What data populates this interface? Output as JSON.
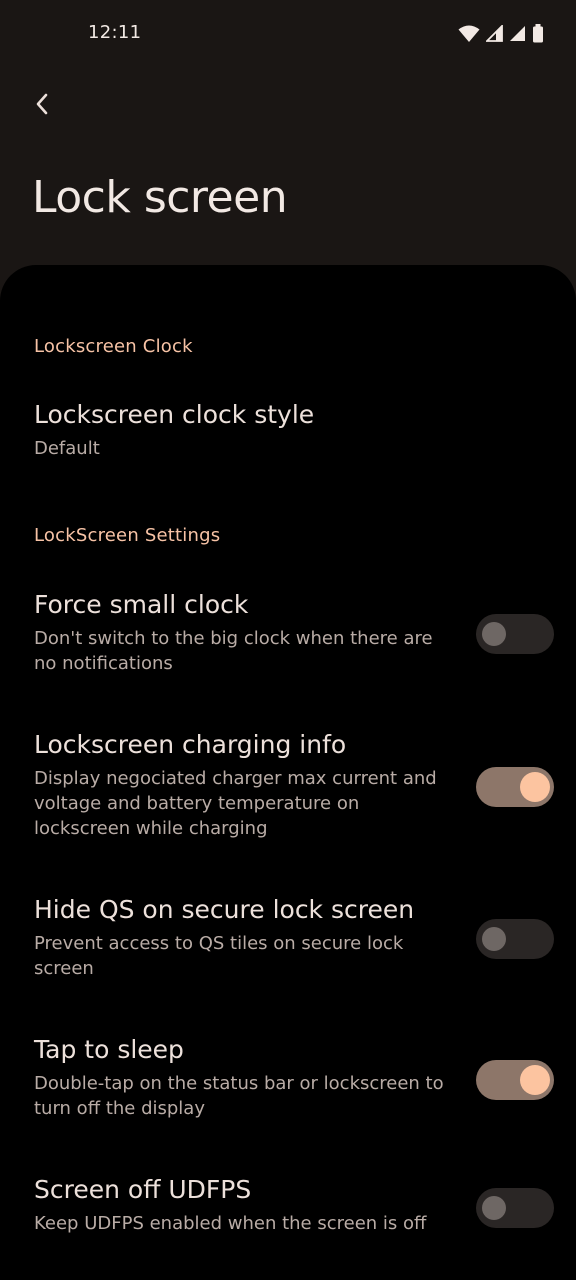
{
  "status_bar": {
    "time": "12:11",
    "icons": [
      "wifi-icon",
      "signal-icon",
      "signal-icon",
      "battery-icon"
    ]
  },
  "colors": {
    "accent": "#f7c3a6",
    "background_top": "#1a1614",
    "background_sheet": "#000000",
    "toggle_on_track": "#8d7669",
    "toggle_on_thumb": "#fcc4a0",
    "toggle_off_track": "#2a2625"
  },
  "header": {
    "back_icon": "chevron-left-icon",
    "title": "Lock screen"
  },
  "sections": [
    {
      "header": "Lockscreen Clock",
      "items": [
        {
          "title": "Lockscreen clock style",
          "summary": "Default"
        }
      ]
    },
    {
      "header": "LockScreen Settings",
      "items": [
        {
          "title": "Force small clock",
          "summary": "Don't switch to the big clock when there are no notifications",
          "toggle": false
        },
        {
          "title": "Lockscreen charging info",
          "summary": "Display negociated charger max current and voltage and battery temperature on lockscreen while charging",
          "toggle": true
        },
        {
          "title": "Hide QS on secure lock screen",
          "summary": "Prevent access to QS tiles on secure lock screen",
          "toggle": false
        },
        {
          "title": "Tap to sleep",
          "summary": "Double-tap on the status bar or lockscreen to turn off the display",
          "toggle": true
        },
        {
          "title": "Screen off UDFPS",
          "summary": "Keep UDFPS enabled when the screen is off",
          "toggle": false
        }
      ]
    }
  ]
}
